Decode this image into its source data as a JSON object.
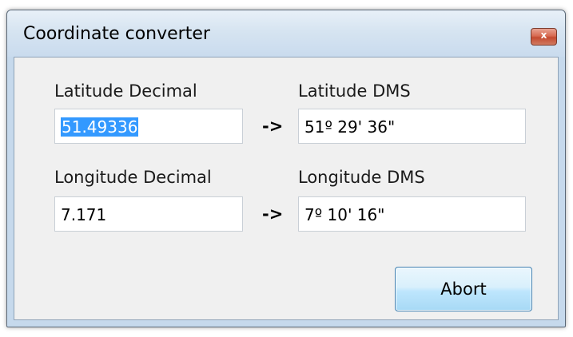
{
  "window": {
    "title": "Coordinate converter",
    "close_glyph": "x"
  },
  "latitude": {
    "decimal_label": "Latitude Decimal",
    "decimal_value": "51.49336",
    "arrow": "->",
    "dms_label": "Latitude DMS",
    "dms_value": "51º 29' 36\""
  },
  "longitude": {
    "decimal_label": "Longitude Decimal",
    "decimal_value": "7.171",
    "arrow": "->",
    "dms_label": "Longitude DMS",
    "dms_value": "7º 10' 16\""
  },
  "buttons": {
    "abort_label": "Abort"
  },
  "colors": {
    "selection": "#3399ff",
    "titlebar": "#d6e4f1",
    "close_button": "#c44a30",
    "button_border": "#3c7fb1"
  },
  "icons": {
    "close": "close-icon"
  }
}
